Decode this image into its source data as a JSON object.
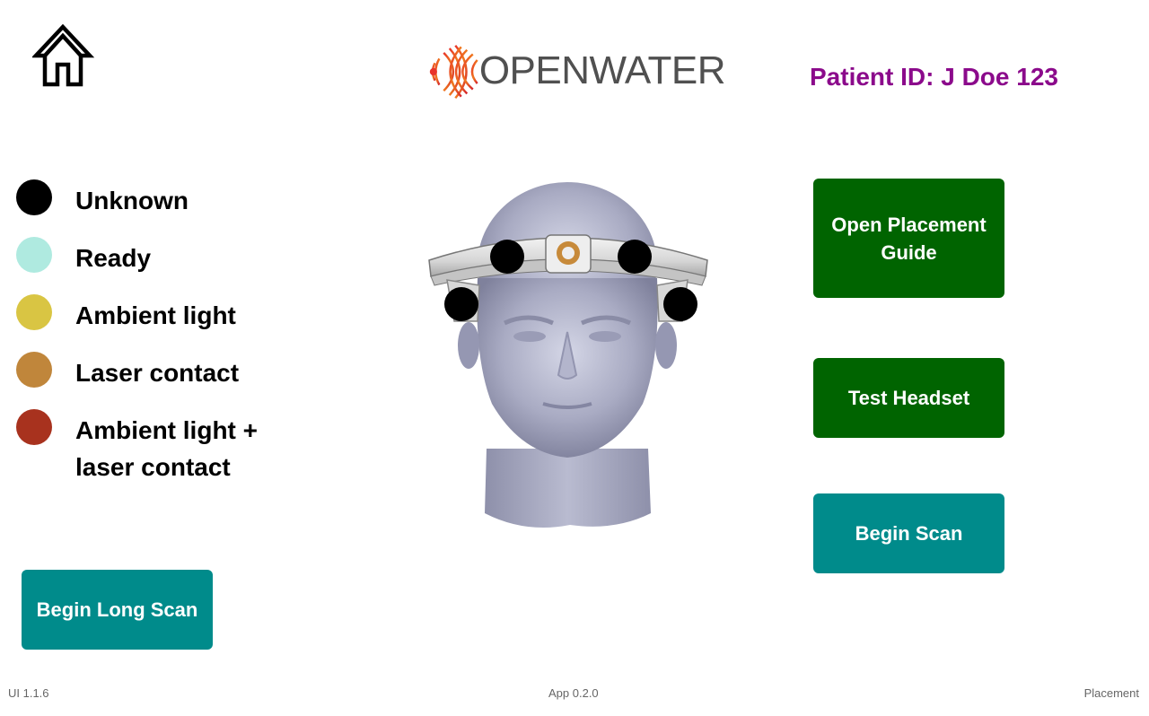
{
  "header": {
    "home_icon": "home-icon",
    "logo_text": "OPENWATER",
    "patient_id": "Patient ID: J Doe 123"
  },
  "legend": {
    "items": [
      {
        "label": "Unknown",
        "color": "#000000"
      },
      {
        "label": "Ready",
        "color": "#afeae0"
      },
      {
        "label": "Ambient light",
        "color": "#d9c543"
      },
      {
        "label": "Laser contact",
        "color": "#c0863b"
      },
      {
        "label": "Ambient light + laser contact",
        "color": "#a8321e"
      }
    ]
  },
  "headset": {
    "sensor_status": [
      "Unknown",
      "Unknown",
      "Unknown",
      "Unknown"
    ],
    "sensor_color": "#000000"
  },
  "actions": {
    "placement_guide_label": "Open Placement Guide",
    "test_headset_label": "Test Headset",
    "begin_scan_label": "Begin Scan",
    "begin_long_scan_label": "Begin Long Scan"
  },
  "footer": {
    "ui_version": "UI 1.1.6",
    "app_version": "App 0.2.0",
    "page_name": "Placement"
  },
  "colors": {
    "patient_id": "#8b0a8b",
    "green_button": "#006400",
    "teal_button": "#008b8b"
  }
}
